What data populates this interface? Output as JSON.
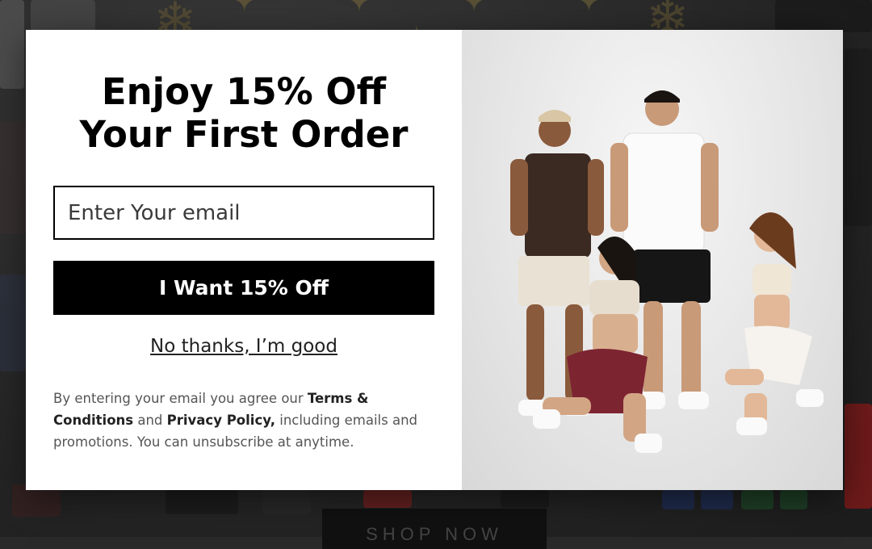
{
  "modal": {
    "headline_line1": "Enjoy 15% Off",
    "headline_line2": "Your First Order",
    "email_placeholder": "Enter Your email",
    "cta_label": "I Want 15% Off",
    "decline_label": "No thanks, I’m good",
    "legal": {
      "prefix": "By entering your email you agree our ",
      "terms": "Terms & Conditions",
      "and": " and ",
      "privacy": "Privacy Policy,",
      "suffix": " including emails and promotions. You can unsubscribe at anytime."
    },
    "image_alt": "Four models wearing tees and bandana-print shorts"
  },
  "background": {
    "shop_button_label": "SHOP NOW",
    "accent_color": "#7a6a3a"
  },
  "colors": {
    "cta_bg": "#000000",
    "cta_text": "#ffffff",
    "overlay": "#262626"
  }
}
